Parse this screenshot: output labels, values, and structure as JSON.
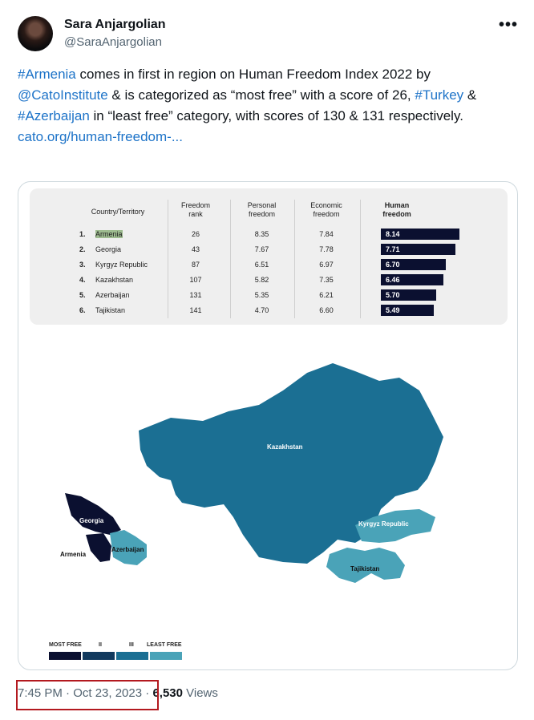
{
  "author": {
    "name": "Sara Anjargolian",
    "handle": "@SaraAnjargolian"
  },
  "more_label": "•••",
  "tweet": {
    "hashtag_armenia": "#Armenia",
    "text_1": " comes in first in region on Human Freedom Index 2022 by ",
    "mention_cato": "@CatoInstitute",
    "text_2": " & is categorized as “most free” with a score of 26, ",
    "hashtag_turkey": "#Turkey",
    "text_3": " & ",
    "hashtag_azerbaijan": "#Azerbaijan",
    "text_4": " in “least free” category, with scores of 130 & 131 respectively.",
    "link": "cato.org/human-freedom-..."
  },
  "image": {
    "table": {
      "headers": {
        "country": "Country/Territory",
        "rank": "Freedom rank",
        "personal": "Personal freedom",
        "economic": "Economic freedom",
        "human": "Human freedom"
      },
      "rows": [
        {
          "num": "1.",
          "country": "Armenia",
          "rank": "26",
          "personal": "8.35",
          "economic": "7.84",
          "human": "8.14",
          "human_value": 8.14
        },
        {
          "num": "2.",
          "country": "Georgia",
          "rank": "43",
          "personal": "7.67",
          "economic": "7.78",
          "human": "7.71",
          "human_value": 7.71
        },
        {
          "num": "3.",
          "country": "Kyrgyz Republic",
          "rank": "87",
          "personal": "6.51",
          "economic": "6.97",
          "human": "6.70",
          "human_value": 6.7
        },
        {
          "num": "4.",
          "country": "Kazakhstan",
          "rank": "107",
          "personal": "5.82",
          "economic": "7.35",
          "human": "6.46",
          "human_value": 6.46
        },
        {
          "num": "5.",
          "country": "Azerbaijan",
          "rank": "131",
          "personal": "5.35",
          "economic": "6.21",
          "human": "5.70",
          "human_value": 5.7
        },
        {
          "num": "6.",
          "country": "Tajikistan",
          "rank": "141",
          "personal": "4.70",
          "economic": "6.60",
          "human": "5.49",
          "human_value": 5.49
        }
      ]
    },
    "map_labels": {
      "kazakhstan": "Kazakhstan",
      "georgia": "Georgia",
      "armenia": "Armenia",
      "azerbaijan": "Azerbaijan",
      "kyrgyz": "Kyrgyz Republic",
      "tajikistan": "Tajikistan"
    },
    "legend": {
      "most_free": "MOST FREE",
      "ii": "II",
      "iii": "III",
      "least_free": "LEAST FREE",
      "colors": [
        "#0b1030",
        "#123a5e",
        "#1b6f93",
        "#4aa3b8"
      ]
    }
  },
  "footer": {
    "time": "7:45 PM · Oct 23, 2023",
    "separator": " · ",
    "views_count": "6,530",
    "views_label": " Views"
  }
}
